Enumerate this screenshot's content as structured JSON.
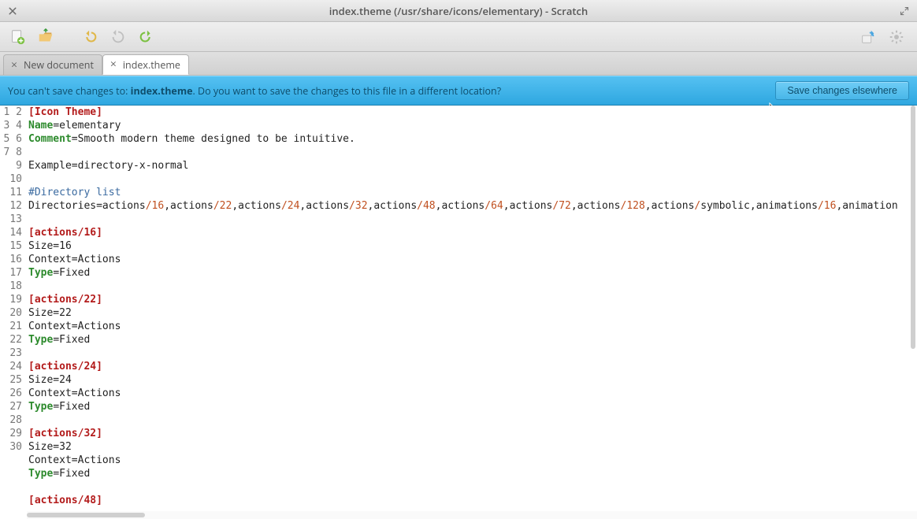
{
  "window": {
    "title": "index.theme (/usr/share/icons/elementary) - Scratch"
  },
  "tabs": [
    {
      "label": "New document",
      "active": false
    },
    {
      "label": "index.theme",
      "active": true
    }
  ],
  "infobar": {
    "prefix": "You can't save changes to: ",
    "filename": "index.theme",
    "suffix": ". Do you want to save the changes to this file in a different location?",
    "button": "Save changes elsewhere"
  },
  "editor": {
    "lines": [
      {
        "t": "section",
        "text": "[Icon Theme]"
      },
      {
        "t": "kv",
        "key": "Name",
        "value": "elementary"
      },
      {
        "t": "kv",
        "key": "Comment",
        "value": "Smooth modern theme designed to be intuitive."
      },
      {
        "t": "blank"
      },
      {
        "t": "plain",
        "text": "Example=directory-x-normal"
      },
      {
        "t": "blank"
      },
      {
        "t": "comment",
        "text": "#Directory list"
      },
      {
        "t": "dirlist",
        "prefix": "Directories=",
        "items": [
          "actions/16",
          "actions/22",
          "actions/24",
          "actions/32",
          "actions/48",
          "actions/64",
          "actions/72",
          "actions/128",
          "actions/symbolic",
          "animations/16",
          "animation"
        ]
      },
      {
        "t": "blank"
      },
      {
        "t": "section",
        "text": "[actions/16]"
      },
      {
        "t": "plain",
        "text": "Size=16"
      },
      {
        "t": "plain",
        "text": "Context=Actions"
      },
      {
        "t": "kv",
        "key": "Type",
        "value": "Fixed"
      },
      {
        "t": "blank"
      },
      {
        "t": "section",
        "text": "[actions/22]"
      },
      {
        "t": "plain",
        "text": "Size=22"
      },
      {
        "t": "plain",
        "text": "Context=Actions"
      },
      {
        "t": "kv",
        "key": "Type",
        "value": "Fixed"
      },
      {
        "t": "blank"
      },
      {
        "t": "section",
        "text": "[actions/24]"
      },
      {
        "t": "plain",
        "text": "Size=24"
      },
      {
        "t": "plain",
        "text": "Context=Actions"
      },
      {
        "t": "kv",
        "key": "Type",
        "value": "Fixed"
      },
      {
        "t": "blank"
      },
      {
        "t": "section",
        "text": "[actions/32]"
      },
      {
        "t": "plain",
        "text": "Size=32"
      },
      {
        "t": "plain",
        "text": "Context=Actions"
      },
      {
        "t": "kv",
        "key": "Type",
        "value": "Fixed"
      },
      {
        "t": "blank"
      },
      {
        "t": "section",
        "text": "[actions/48]"
      }
    ]
  }
}
